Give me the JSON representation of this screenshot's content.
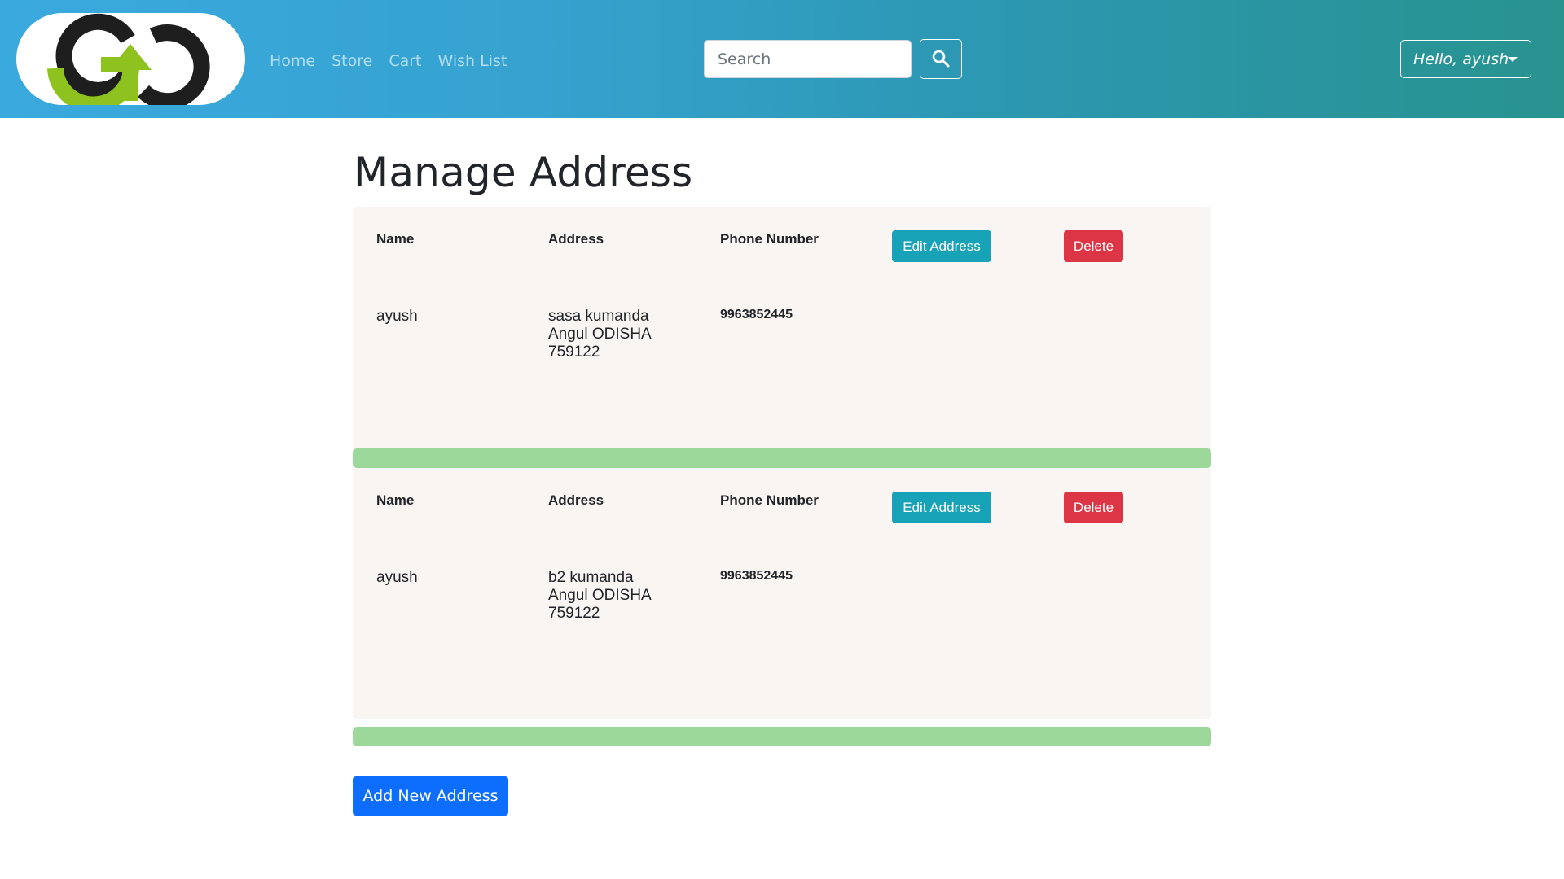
{
  "header": {
    "logo_alt": "GO",
    "nav": [
      {
        "label": "Home"
      },
      {
        "label": "Store"
      },
      {
        "label": "Cart"
      },
      {
        "label": "Wish List"
      }
    ],
    "search": {
      "placeholder": "Search",
      "icon": "search-icon"
    },
    "user_menu": {
      "label": "Hello, ayush",
      "icon": "caret-down-icon"
    }
  },
  "colors": {
    "header_gradient_start": "#3aa9de",
    "header_gradient_end": "#28938f",
    "edit_button": "#17a2b8",
    "delete_button": "#dc3545",
    "add_button": "#0d6efd",
    "separator_bar": "#9bd89a",
    "card_background": "#f9f5f2",
    "logo_green": "#8dc21f"
  },
  "main": {
    "title": "Manage Address",
    "column_labels": {
      "name": "Name",
      "address": "Address",
      "phone": "Phone Number"
    },
    "addresses": [
      {
        "name": "ayush",
        "address_lines": [
          "sasa kumanda",
          "Angul ODISHA",
          "759122"
        ],
        "phone": "9963852445",
        "edit_label": "Edit Address",
        "delete_label": "Delete"
      },
      {
        "name": "ayush",
        "address_lines": [
          "b2 kumanda",
          "Angul ODISHA",
          "759122"
        ],
        "phone": "9963852445",
        "edit_label": "Edit Address",
        "delete_label": "Delete"
      }
    ],
    "add_button_label": "Add New Address"
  }
}
